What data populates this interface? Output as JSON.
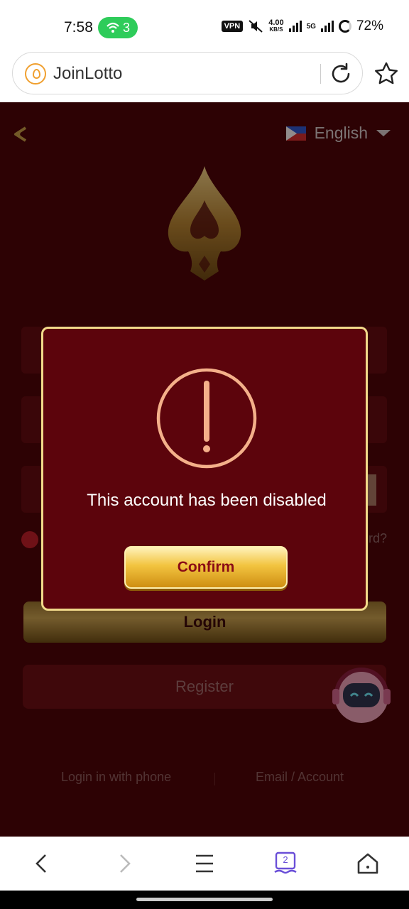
{
  "status_bar": {
    "time": "7:58",
    "wifi_count": "3",
    "vpn_label": "VPN",
    "speed_value": "4.00",
    "speed_unit": "KB/S",
    "network": "5G",
    "battery": "72%",
    "accent_color": "#2ecc5a"
  },
  "browser": {
    "url": "JoinLotto",
    "site_icon": "site-drop-icon",
    "reload_icon": "reload-icon",
    "bookmark_icon": "star-icon"
  },
  "page": {
    "language": "English",
    "flag_icon": "philippines-flag-icon",
    "forgot_password_partial": "rd?",
    "login_label": "Login",
    "register_label": "Register",
    "phone_login": "Login in with phone",
    "email_login": "Email / Account",
    "theme_color": "#4a0408",
    "gold_color": "#caa752"
  },
  "dialog": {
    "message": "This account has been disabled",
    "confirm_label": "Confirm",
    "icon": "exclamation-circle-icon"
  },
  "nav": {
    "back_icon": "chevron-left-icon",
    "forward_icon": "chevron-right-icon",
    "menu_icon": "menu-icon",
    "tabs_count": "2",
    "home_icon": "home-icon"
  }
}
